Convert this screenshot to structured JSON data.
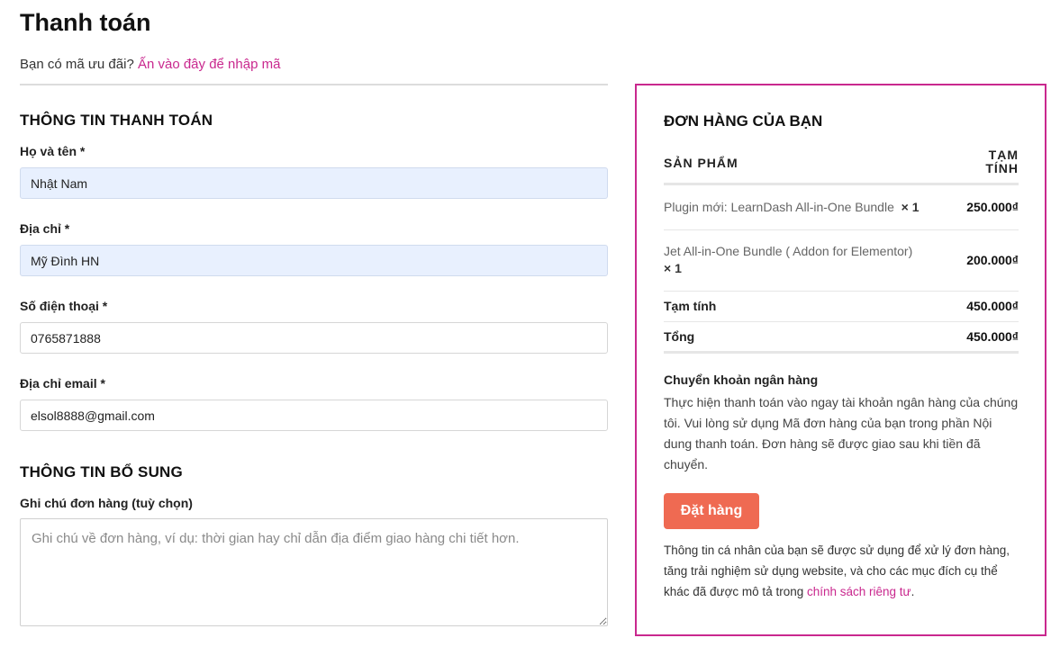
{
  "page": {
    "title": "Thanh toán",
    "coupon_prompt": "Bạn có mã ưu đãi?",
    "coupon_link": "Ấn vào đây để nhập mã"
  },
  "billing": {
    "section_title": "THÔNG TIN THANH TOÁN",
    "fields": [
      {
        "label": "Họ và tên *",
        "value": "Nhật Nam"
      },
      {
        "label": "Địa chỉ *",
        "value": "Mỹ Đình HN"
      },
      {
        "label": "Số điện thoại *",
        "value": "0765871888"
      },
      {
        "label": "Địa chỉ email *",
        "value": "elsol8888@gmail.com"
      }
    ]
  },
  "additional": {
    "section_title": "THÔNG TIN BỔ SUNG",
    "notes_label": "Ghi chú đơn hàng (tuỳ chọn)",
    "notes_placeholder": "Ghi chú về đơn hàng, ví dụ: thời gian hay chỉ dẫn địa điểm giao hàng chi tiết hơn."
  },
  "order": {
    "title": "ĐƠN HÀNG CỦA BẠN",
    "col_product": "SẢN PHẨM",
    "col_subtotal_line1": "TẠM",
    "col_subtotal_line2": "TÍNH",
    "items": [
      {
        "name": "Plugin mới: LearnDash All-in-One Bundle",
        "qty": "× 1",
        "price": "250.000₫"
      },
      {
        "name": "Jet All-in-One Bundle ( Addon for Elementor)",
        "qty": "× 1",
        "price": "200.000₫"
      }
    ],
    "subtotal_label": "Tạm tính",
    "subtotal_value": "450.000₫",
    "total_label": "Tổng",
    "total_value": "450.000₫",
    "payment_method_title": "Chuyển khoản ngân hàng",
    "payment_method_desc": "Thực hiện thanh toán vào ngay tài khoản ngân hàng của chúng tôi. Vui lòng sử dụng Mã đơn hàng của bạn trong phần Nội dung thanh toán. Đơn hàng sẽ được giao sau khi tiền đã chuyển.",
    "place_order_label": "Đặt hàng",
    "privacy_text": "Thông tin cá nhân của bạn sẽ được sử dụng để xử lý đơn hàng, tăng trải nghiệm sử dụng website, và cho các mục đích cụ thể khác đã được mô tả trong",
    "privacy_link": "chính sách riêng tư",
    "privacy_end": "."
  },
  "colors": {
    "accent": "#c9288e",
    "button": "#ef6a52",
    "autofill_bg": "#e8f0fe"
  }
}
